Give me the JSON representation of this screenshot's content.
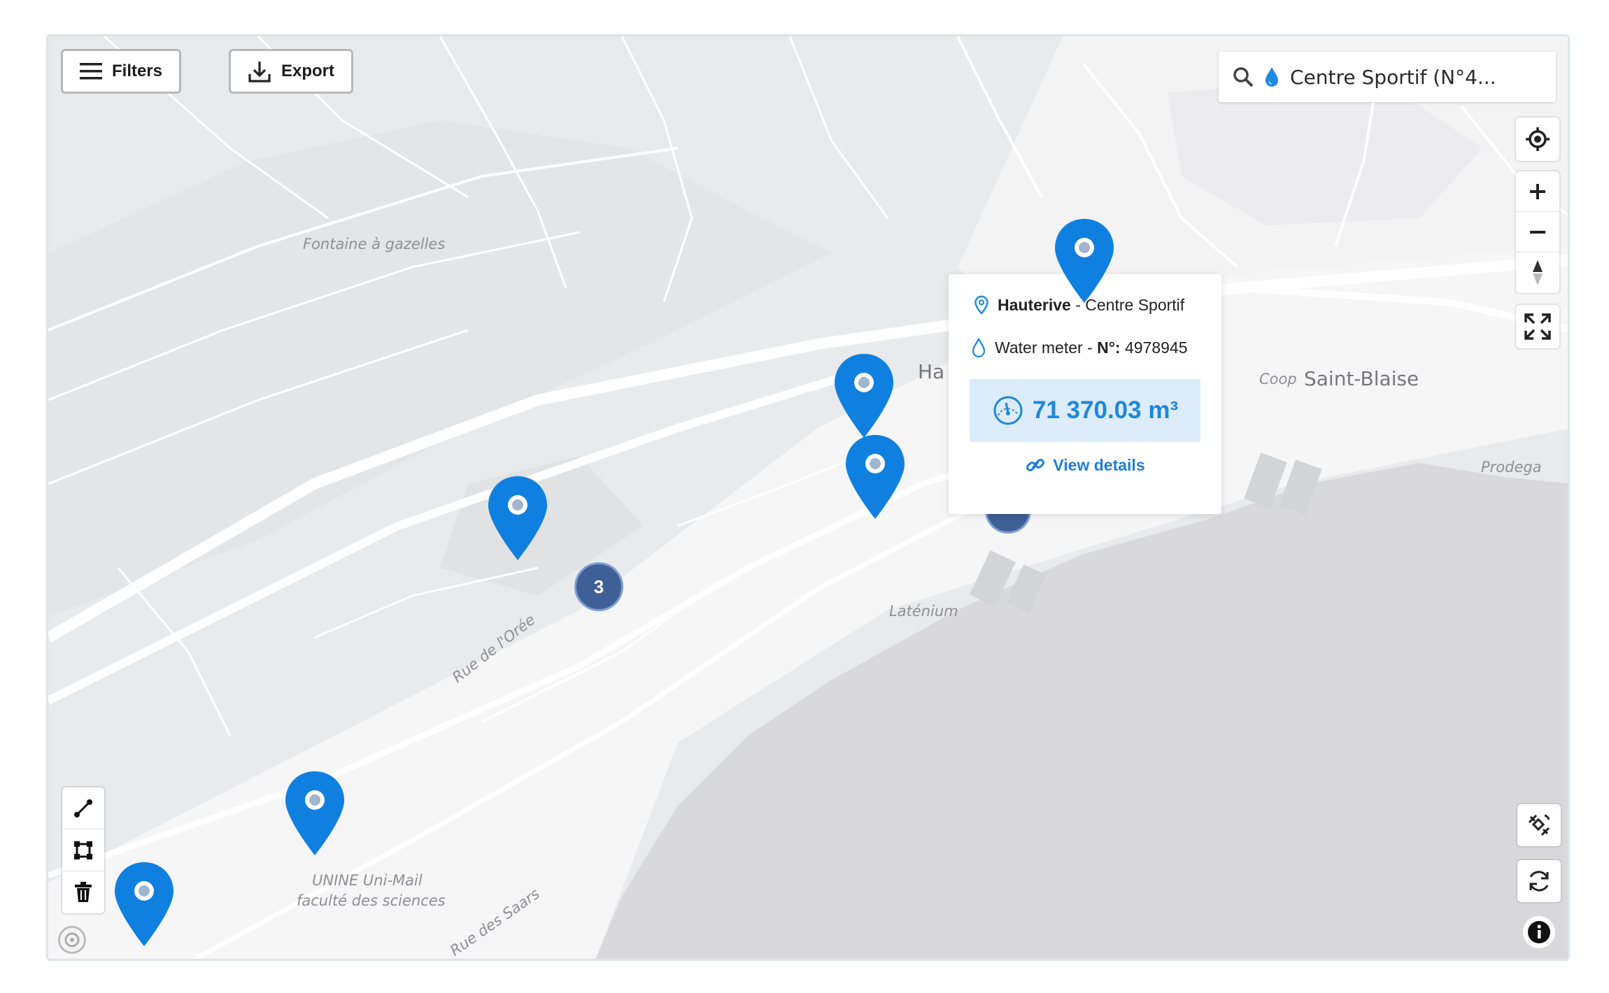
{
  "toolbar": {
    "filters_label": "Filters",
    "export_label": "Export"
  },
  "search": {
    "value": "Centre Sportif (N°4..."
  },
  "map_labels": {
    "fontaine": "Fontaine à gazelles",
    "hauterive_partial": "Ha",
    "coop": "Coop",
    "saint_blaise": "Saint-Blaise",
    "prodega": "Prodega",
    "latenium": "Laténium",
    "rue_oree": "Rue de l'Orée",
    "unine_1": "UNINE Uni-Mail",
    "unine_2": "faculté des sciences",
    "rue_saars": "Rue des Saars"
  },
  "cluster": {
    "count": "3"
  },
  "popup": {
    "location_bold": "Hauterive",
    "location_rest": " - Centre Sportif",
    "meter_label": "Water meter - ",
    "meter_no_label": "N°:",
    "meter_no_value": " 4978945",
    "reading": "71 370.03 m³",
    "details_label": "View details"
  },
  "colors": {
    "pin": "#0f80e0",
    "cluster": "#3f5f97",
    "water": "#d9d9db",
    "land": "#e9eaec",
    "accent": "#1e88d8"
  }
}
